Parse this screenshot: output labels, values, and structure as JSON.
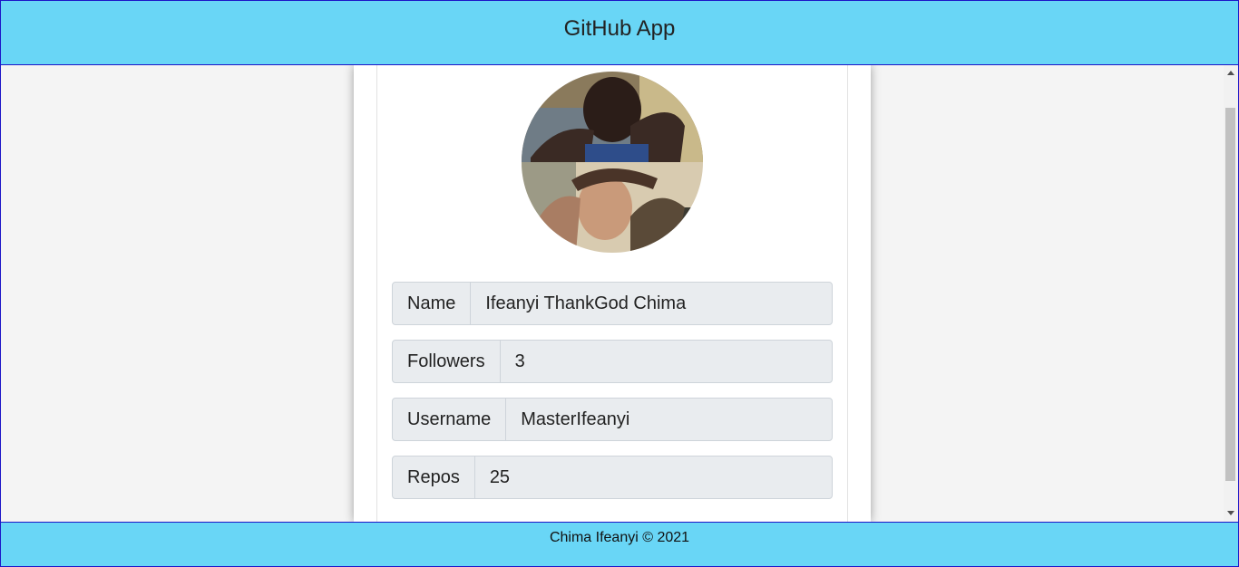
{
  "header": {
    "title": "GitHub App"
  },
  "profile": {
    "avatar_alt": "profile picture",
    "fields": [
      {
        "label": "Name",
        "value": "Ifeanyi ThankGod Chima"
      },
      {
        "label": "Followers",
        "value": "3"
      },
      {
        "label": "Username",
        "value": "MasterIfeanyi"
      },
      {
        "label": "Repos",
        "value": "25"
      }
    ]
  },
  "footer": {
    "text": "Chima Ifeanyi © 2021"
  },
  "colors": {
    "header_bg": "#69d6f6",
    "footer_bg": "#69d6f6",
    "border": "#1c16c8",
    "field_bg": "#e9ecef"
  }
}
